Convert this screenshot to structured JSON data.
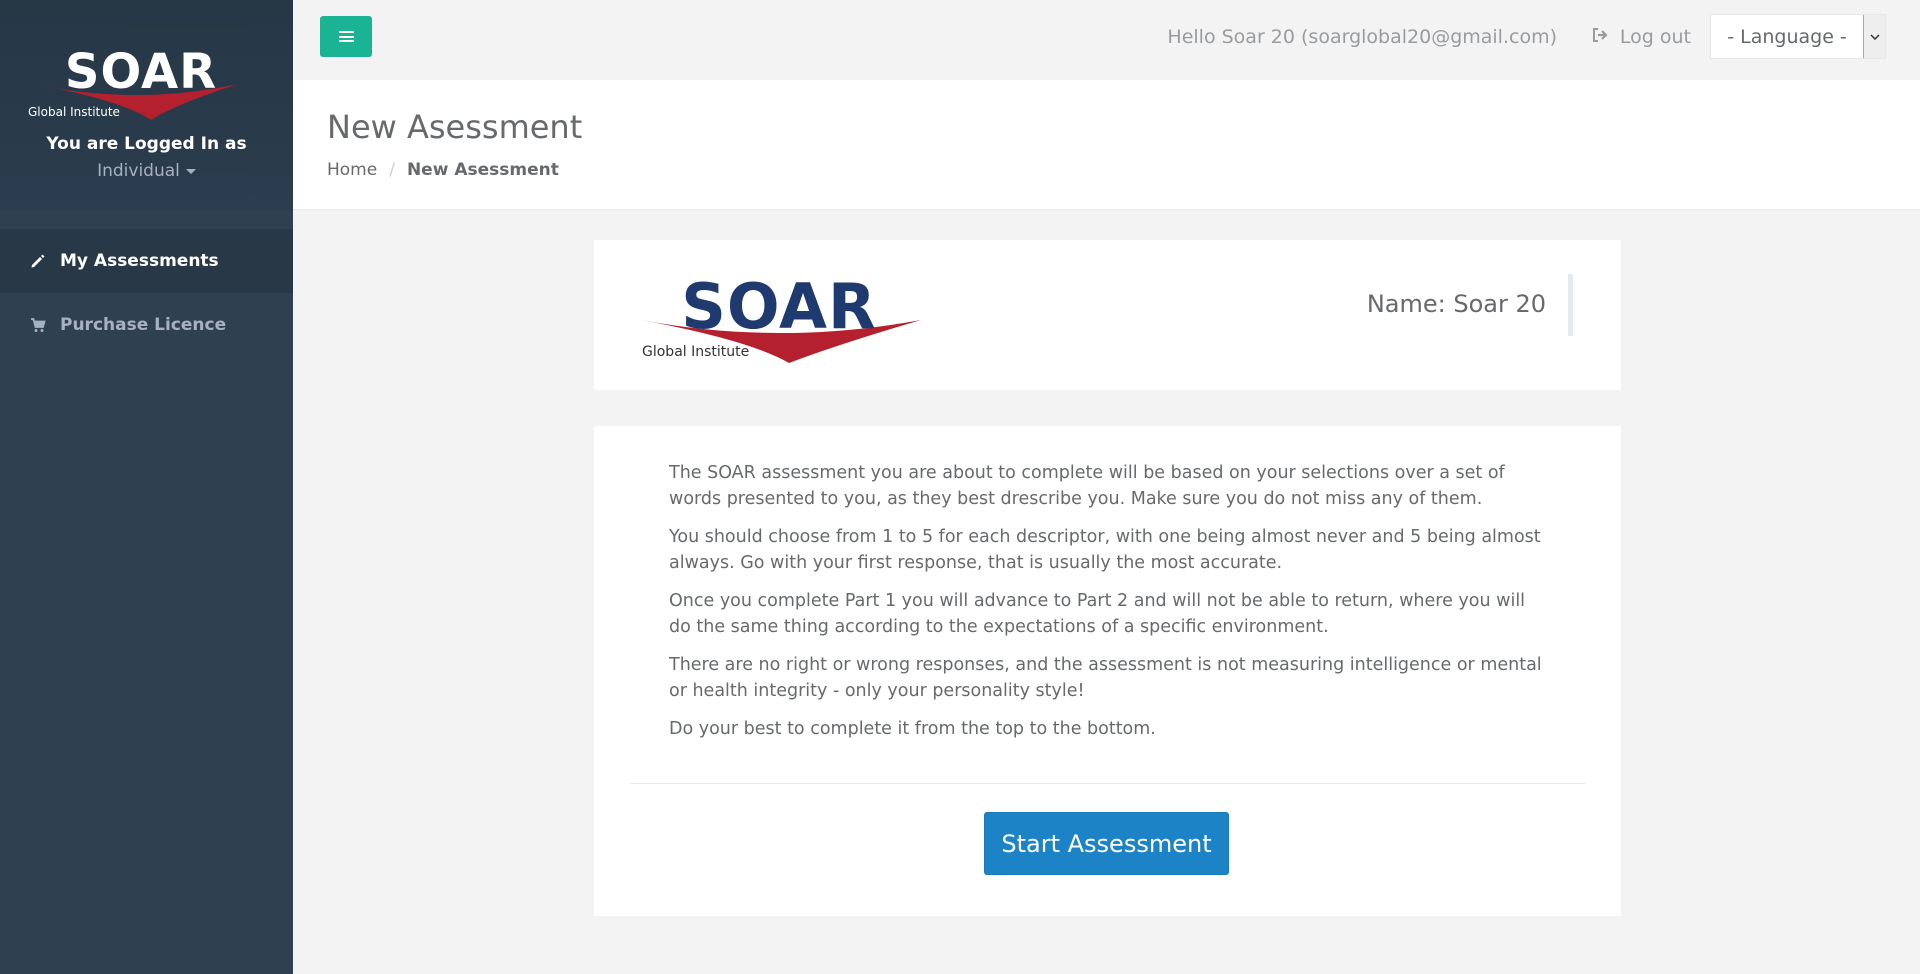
{
  "sidebar": {
    "logo": {
      "wordmark": "SOAR",
      "tagline": "Global Institute"
    },
    "logged_in_label": "You are Logged In as",
    "role": "Individual",
    "items": [
      {
        "label": "My Assessments",
        "icon": "pencil-icon",
        "active": true
      },
      {
        "label": "Purchase Licence",
        "icon": "cart-icon",
        "active": false
      }
    ]
  },
  "topbar": {
    "menu_icon": "hamburger-icon",
    "greeting": "Hello Soar 20 (soarglobal20@gmail.com)",
    "logout_label": "Log out",
    "logout_icon": "sign-out-icon",
    "language_value": "- Language -"
  },
  "heading": {
    "title": "New Asessment",
    "breadcrumb": [
      "Home",
      "New Asessment"
    ]
  },
  "header_card": {
    "logo": {
      "wordmark": "SOAR",
      "tagline": "Global Institute"
    },
    "name_label": "Name: Soar 20"
  },
  "instructions": {
    "paragraphs": [
      "The SOAR assessment you are about to complete will be based on your selections over a set of words presented to you, as they best drescribe you. Make sure you do not miss any of them.",
      "You should choose from 1 to 5 for each descriptor, with one being almost never and 5 being almost always. Go with your first response, that is usually the most accurate.",
      "Once you complete Part 1 you will advance to Part 2 and will not be able to return, where you will do the same thing according to the expectations of a specific environment.",
      "There are no right or wrong responses, and the assessment is not measuring intelligence or mental or health integrity - only your personality style!",
      "Do your best to complete it from the top to the bottom."
    ],
    "start_button": "Start Assessment"
  },
  "colors": {
    "sidebar_bg": "#2f4050",
    "accent_green": "#1ab394",
    "primary_blue": "#1c84c6",
    "logo_navy": "#1f3a6e",
    "logo_red": "#b5202e"
  }
}
